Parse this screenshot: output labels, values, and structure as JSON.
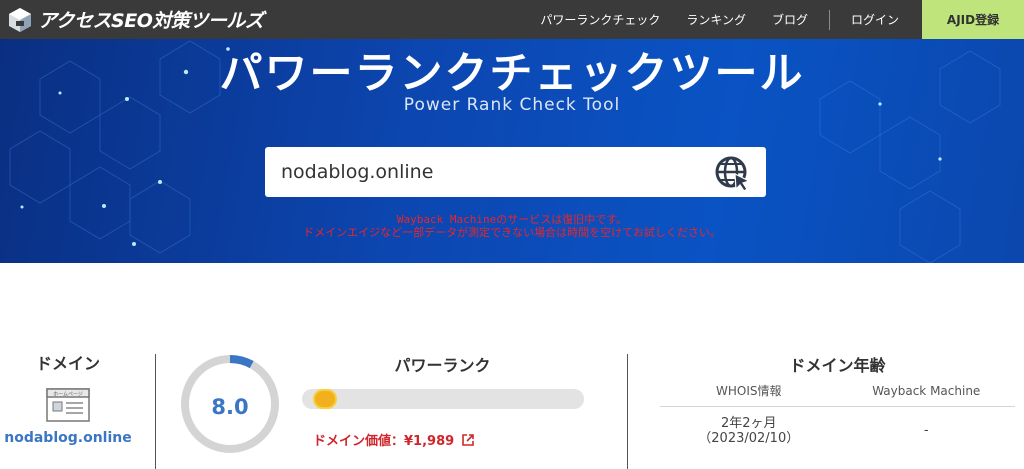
{
  "header": {
    "logo_text": "アクセスSEO対策ツールズ",
    "nav": [
      "パワーランクチェック",
      "ランキング",
      "ブログ",
      "ログイン"
    ],
    "cta": "AJID登録"
  },
  "hero": {
    "title": "パワーランクチェックツール",
    "subtitle": "Power Rank Check Tool",
    "search_value": "nodablog.online",
    "notice_line1": "Wayback Machineのサービスは復旧中です。",
    "notice_line2": "ドメインエイジなど一部データが測定できない場合は時間を空けてお試しください。"
  },
  "domain_panel": {
    "label": "ドメイン",
    "icon_caption": "ホームページ",
    "domain": "nodablog.online"
  },
  "power_rank": {
    "label": "パワーランク",
    "score": "8.0",
    "score_fraction": 0.08,
    "value_label": "ドメイン価値：",
    "value": "¥1,989"
  },
  "domain_age": {
    "label": "ドメイン年齢",
    "col_whois": "WHOIS情報",
    "col_wayback": "Wayback Machine",
    "whois_age": "2年2ヶ月",
    "whois_date": "（2023/02/10）",
    "wayback_value": "-"
  },
  "colors": {
    "nav_bg": "#3a3a3a",
    "cta_bg": "#bfe47c",
    "hero_blue": "#0a4fbc",
    "notice_red": "#e8262c",
    "link_blue": "#3a76c4",
    "knob_yellow": "#f2b01e"
  }
}
